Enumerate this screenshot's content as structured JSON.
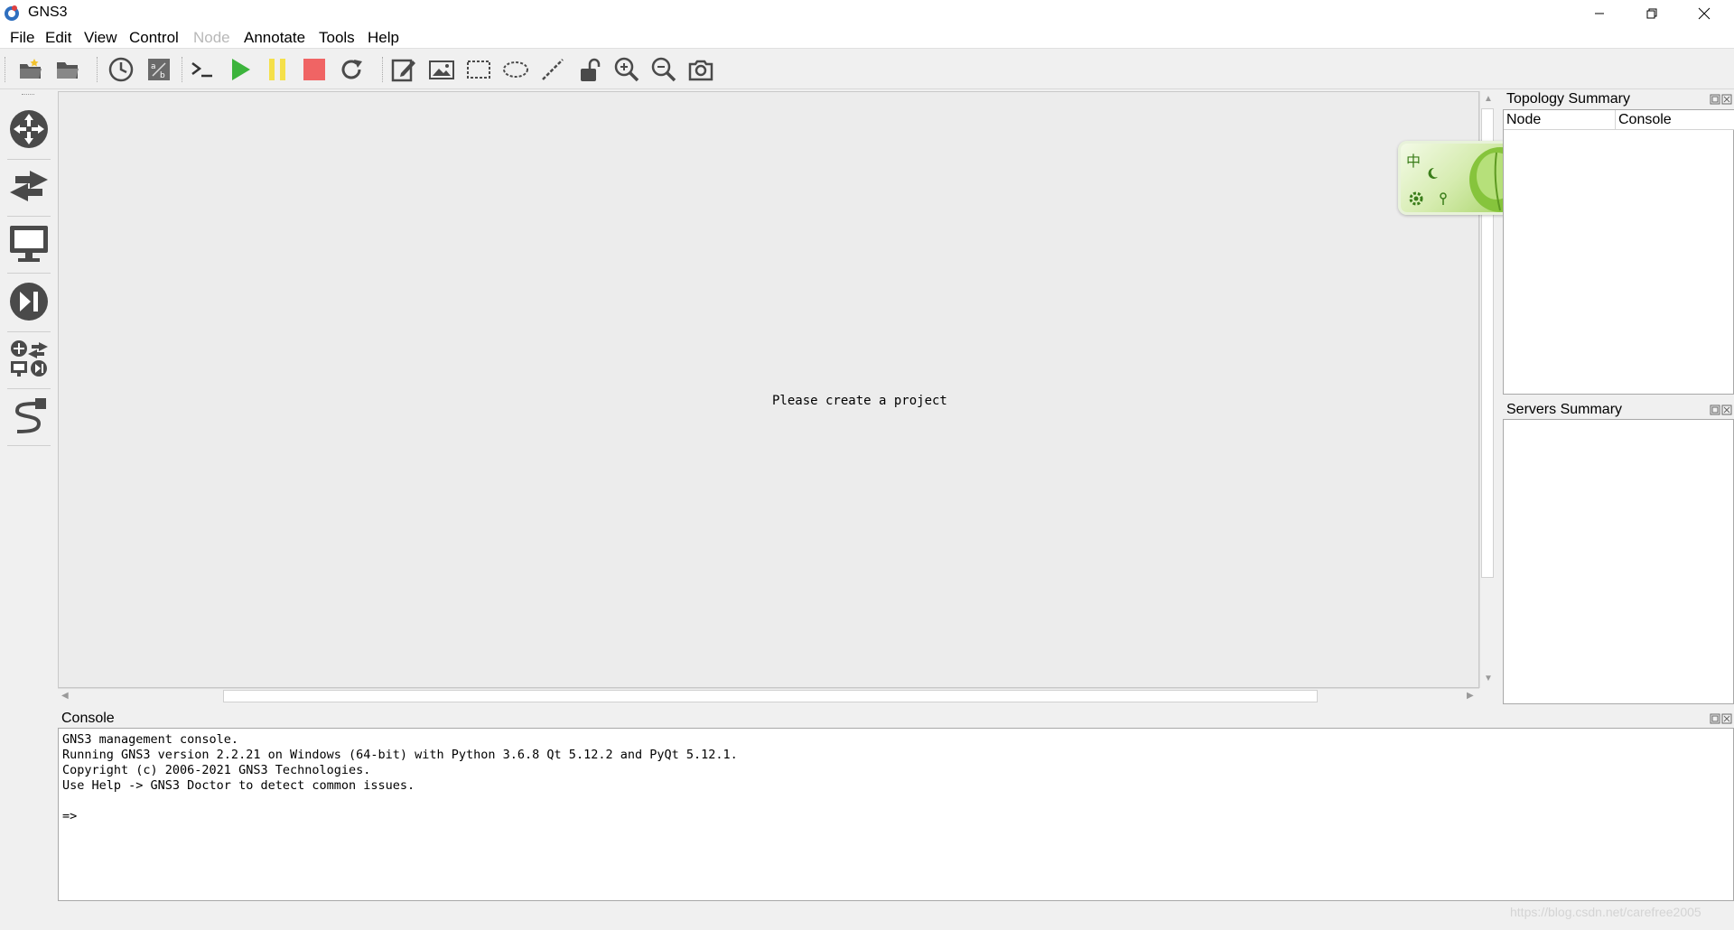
{
  "window": {
    "title": "GNS3"
  },
  "menu": [
    "File",
    "Edit",
    "View",
    "Control",
    "Node",
    "Annotate",
    "Tools",
    "Help"
  ],
  "menu_disabled": [
    "Node"
  ],
  "toolbar": {
    "icons": [
      "new-project-icon",
      "open-project-icon",
      "snapshot-icon",
      "show-interface-labels-icon",
      "console-all-icon",
      "start-all-icon",
      "suspend-all-icon",
      "stop-all-icon",
      "reload-all-icon",
      "add-note-icon",
      "insert-picture-icon",
      "draw-rectangle-icon",
      "draw-ellipse-icon",
      "draw-line-icon",
      "lock-unlock-icon",
      "zoom-in-icon",
      "zoom-out-icon",
      "screenshot-icon"
    ]
  },
  "left_toolbar": {
    "icons": [
      "routers-icon",
      "switches-icon",
      "end-devices-icon",
      "security-devices-icon",
      "all-devices-icon",
      "add-link-icon"
    ]
  },
  "canvas": {
    "message": "Please create a project"
  },
  "topology_summary": {
    "title": "Topology Summary",
    "columns": [
      "Node",
      "Console"
    ]
  },
  "servers_summary": {
    "title": "Servers Summary"
  },
  "console": {
    "title": "Console",
    "lines": [
      "GNS3 management console.",
      "Running GNS3 version 2.2.21 on Windows (64-bit) with Python 3.6.8 Qt 5.12.2 and PyQt 5.12.1.",
      "Copyright (c) 2006-2021 GNS3 Technologies.",
      "Use Help -> GNS3 Doctor to detect common issues.",
      "",
      "=>"
    ]
  },
  "ime": {
    "char": "中"
  },
  "watermark": "https://blog.csdn.net/carefree2005",
  "colors": {
    "start": "#3cb43c",
    "suspend": "#f5e04a",
    "stop": "#f06464",
    "icon": "#4a4a4a"
  }
}
